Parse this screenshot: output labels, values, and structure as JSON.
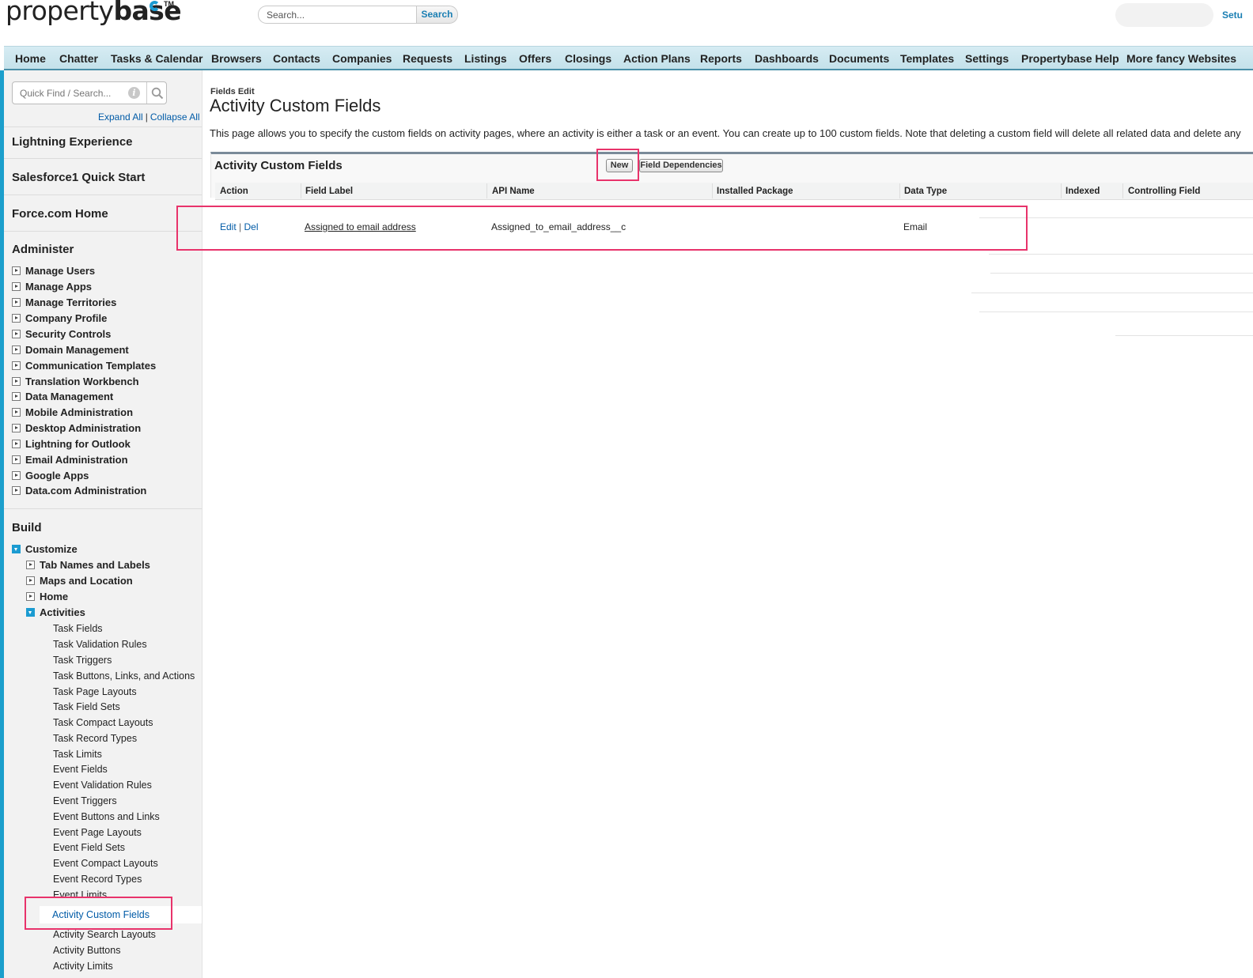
{
  "header": {
    "logo_text_regular": "property",
    "logo_text_bold": "base",
    "logo_trademark": "TM",
    "search_placeholder": "Search...",
    "search_button": "Search",
    "setup_link": "Setu"
  },
  "tabs": [
    "Home",
    "Chatter",
    "Tasks & Calendar",
    "Browsers",
    "Contacts",
    "Companies",
    "Requests",
    "Listings",
    "Offers",
    "Closings",
    "Action Plans",
    "Reports",
    "Dashboards",
    "Documents",
    "Templates",
    "Settings",
    "Propertybase Help",
    "More fancy Websites"
  ],
  "sidebar": {
    "quick_find_placeholder": "Quick Find / Search...",
    "expand_all": "Expand All",
    "separator": "|",
    "collapse_all": "Collapse All",
    "sections": [
      "Lightning Experience",
      "Salesforce1 Quick Start",
      "Force.com Home"
    ],
    "administer": {
      "heading": "Administer",
      "items": [
        "Manage Users",
        "Manage Apps",
        "Manage Territories",
        "Company Profile",
        "Security Controls",
        "Domain Management",
        "Communication Templates",
        "Translation Workbench",
        "Data Management",
        "Mobile Administration",
        "Desktop Administration",
        "Lightning for Outlook",
        "Email Administration",
        "Google Apps",
        "Data.com Administration"
      ]
    },
    "build": {
      "heading": "Build",
      "customize": "Customize",
      "customize_children": [
        "Tab Names and Labels",
        "Maps and Location",
        "Home"
      ],
      "activities": "Activities",
      "activities_children": [
        "Task Fields",
        "Task Validation Rules",
        "Task Triggers",
        "Task Buttons, Links, and Actions",
        "Task Page Layouts",
        "Task Field Sets",
        "Task Compact Layouts",
        "Task Record Types",
        "Task Limits",
        "Event Fields",
        "Event Validation Rules",
        "Event Triggers",
        "Event Buttons and Links",
        "Event Page Layouts",
        "Event Field Sets",
        "Event Compact Layouts",
        "Event Record Types",
        "Event Limits"
      ],
      "selected": "Activity Custom Fields",
      "after_selected": [
        "Activity Search Layouts",
        "Activity Buttons",
        "Activity Limits"
      ]
    }
  },
  "main": {
    "breadcrumb": "Fields Edit",
    "title": "Activity Custom Fields",
    "description": "This page allows you to specify the custom fields on activity pages, where an activity is either a task or an event. You can create up to 100 custom fields. Note that deleting a custom field will delete all related data and delete any",
    "panel_title": "Activity Custom Fields",
    "new_button": "New",
    "field_dependencies_button": "Field Dependencies",
    "columns": [
      "Action",
      "Field Label",
      "API Name",
      "Installed Package",
      "Data Type",
      "Indexed",
      "Controlling Field"
    ],
    "rows": [
      {
        "edit": "Edit",
        "separator": "|",
        "del": "Del",
        "field_label": "Assigned to email address",
        "api_name": "Assigned_to_email_address__c",
        "installed_package": "",
        "data_type": "Email",
        "indexed": "",
        "controlling_field": ""
      }
    ]
  },
  "colors": {
    "accent": "#1b9bd1",
    "link": "#015ba7",
    "highlight": "#e8336b",
    "tabbar": "#c4e1ea"
  }
}
